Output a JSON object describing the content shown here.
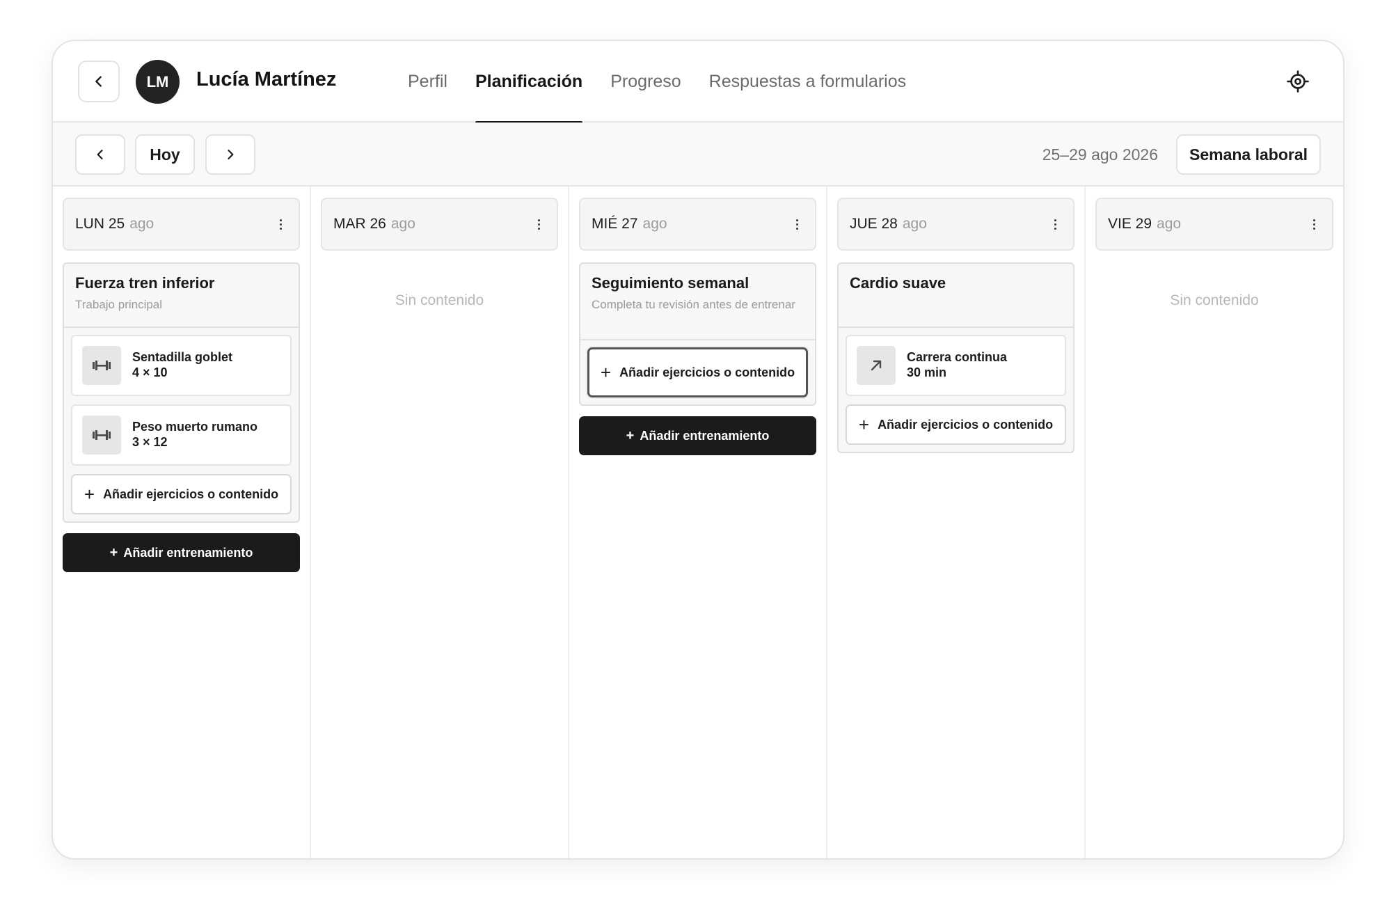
{
  "client": {
    "initials": "LM",
    "name": "Lucía Martínez"
  },
  "tabs": [
    {
      "label": "Perfil",
      "active": false
    },
    {
      "label": "Planificación",
      "active": true
    },
    {
      "label": "Progreso",
      "active": false
    },
    {
      "label": "Respuestas a formularios",
      "active": false
    }
  ],
  "toolbar": {
    "today_label": "Hoy",
    "date_range": "25–29 ago 2026",
    "view_label": "Semana laboral"
  },
  "empty_label": "Sin contenido",
  "add_content_label": "Añadir ejercicios o contenido",
  "add_workout_label": "Añadir entrenamiento",
  "days": [
    {
      "label": "LUN 25",
      "month": "ago",
      "workouts": [
        {
          "title": "Fuerza tren inferior",
          "subtitle": "Trabajo principal",
          "exercises": [
            {
              "icon": "dumbbell-icon",
              "name": "Sentadilla goblet",
              "detail": "4 × 10"
            },
            {
              "icon": "dumbbell-icon",
              "name": "Peso muerto rumano",
              "detail": "3 × 12"
            }
          ]
        }
      ]
    },
    {
      "label": "MAR 26",
      "month": "ago",
      "workouts": []
    },
    {
      "label": "MIÉ 27",
      "month": "ago",
      "workouts": [
        {
          "title": "Seguimiento semanal",
          "subtitle": "Completa tu revisión antes de entrenar",
          "exercises": []
        }
      ]
    },
    {
      "label": "JUE 28",
      "month": "ago",
      "workouts": [
        {
          "title": "Cardio suave",
          "subtitle": "",
          "exercises": [
            {
              "icon": "arrow-up-right-icon",
              "name": "Carrera continua",
              "detail": "30 min"
            }
          ]
        }
      ]
    },
    {
      "label": "VIE 29",
      "month": "ago",
      "workouts": []
    }
  ]
}
